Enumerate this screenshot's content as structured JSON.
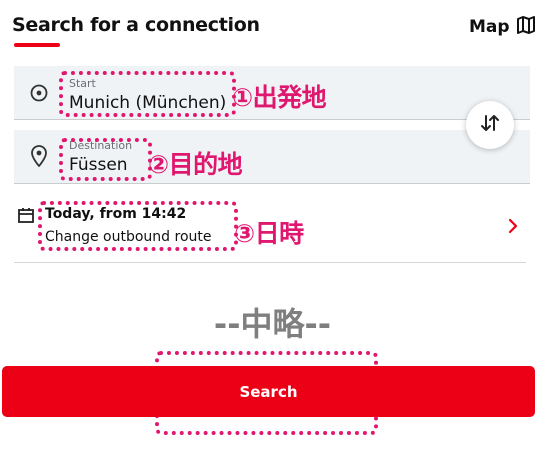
{
  "header": {
    "title": "Search for a connection",
    "map_label": "Map"
  },
  "fields": {
    "start": {
      "label": "Start",
      "value": "Munich (München)",
      "icon": "location-target-icon"
    },
    "destination": {
      "label": "Destination",
      "value": "Füssen",
      "icon": "map-pin-icon"
    }
  },
  "swap": {
    "icon": "swap-arrows-icon"
  },
  "datetime": {
    "title": "Today, from 14:42",
    "subtitle": "Change outbound route",
    "icon": "calendar-icon",
    "chevron": "chevron-right-icon"
  },
  "annotations": {
    "start": "①出発地",
    "destination": "②目的地",
    "datetime": "③日時",
    "omitted": "--中略--"
  },
  "search_button": {
    "label": "Search"
  },
  "colors": {
    "accent": "#ec0016",
    "annotation": "#e0176f",
    "field_bg": "#f0f3f5"
  }
}
